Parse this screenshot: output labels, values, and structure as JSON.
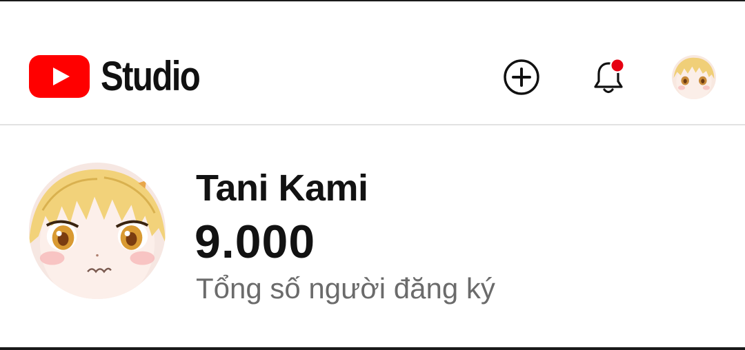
{
  "header": {
    "logo_text": "Studio",
    "icons": [
      "youtube-logo-icon",
      "create-icon",
      "bell-icon",
      "account-avatar"
    ],
    "notification_dot": true
  },
  "channel": {
    "name": "Tani Kami",
    "subscriber_count": "9.000",
    "subscriber_label": "Tổng số người đăng ký"
  },
  "colors": {
    "brand_red": "#ff0000",
    "notification_red": "#e60012",
    "text_primary": "#121212",
    "text_secondary": "#6b6b6b",
    "divider": "#e2e2e2"
  }
}
